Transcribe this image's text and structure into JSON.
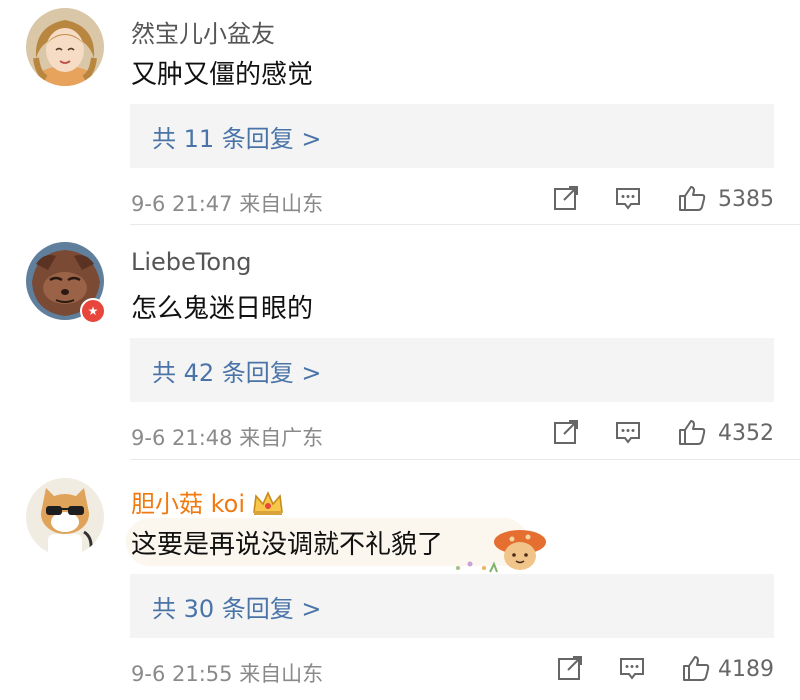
{
  "comments": [
    {
      "username": "然宝儿小盆友",
      "content": "又肿又僵的感觉",
      "replies_label": "共 11 条回复 >",
      "time": "9-6 21:47",
      "location": "来自山东",
      "likes": "5385",
      "avatar_icon": "girl-avatar",
      "vip": false
    },
    {
      "username": "LiebeTong",
      "content": "怎么鬼迷日眼的",
      "replies_label": "共 42 条回复 >",
      "time": "9-6 21:48",
      "location": "来自广东",
      "likes": "4352",
      "avatar_icon": "cartoon-cat-avatar",
      "vip": false
    },
    {
      "username": "胆小菇 koi",
      "content": "这要是再说没调就不礼貌了",
      "replies_label": "共 30 条回复 >",
      "time": "9-6 21:55",
      "location": "来自山东",
      "likes": "4189",
      "avatar_icon": "shiba-dog-avatar",
      "vip": true
    }
  ],
  "colors": {
    "reply_link": "#4a74a8",
    "vip_name": "#f07a12",
    "badge": "#e8453c",
    "reply_bg": "#f4f4f4"
  }
}
